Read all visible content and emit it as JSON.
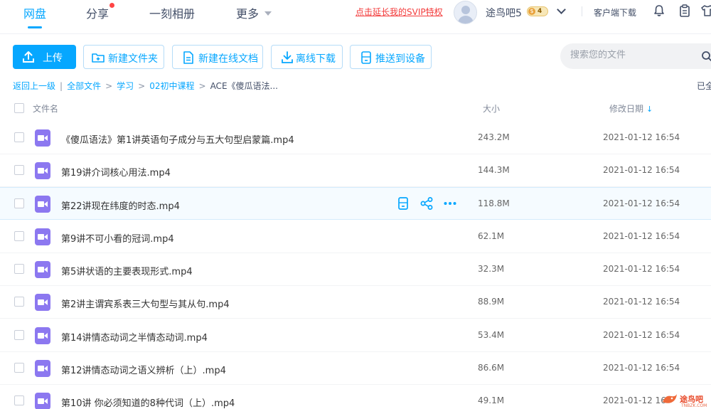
{
  "nav": {
    "tabs": [
      {
        "label": "网盘",
        "active": true
      },
      {
        "label": "分享",
        "has_dot": true
      },
      {
        "label": "一刻相册"
      },
      {
        "label": "更多"
      }
    ],
    "svip_link": "点击延长我的SVIP特权",
    "username": "途鸟吧5",
    "vip_level": "4",
    "client_download": "客户端下载",
    "icons": [
      "bell-icon",
      "clipboard-icon",
      "shirt-icon"
    ]
  },
  "toolbar": {
    "upload": "上传",
    "new_folder": "新建文件夹",
    "new_doc": "新建在线文档",
    "offline_download": "离线下载",
    "push_device": "推送到设备"
  },
  "search": {
    "placeholder": "搜索您的文件"
  },
  "breadcrumb": {
    "back": "返回上一级",
    "items": [
      "全部文件",
      "学习",
      "02初中课程"
    ],
    "current": "ACE《傻瓜语法...",
    "loaded_status": "已全"
  },
  "columns": {
    "name": "文件名",
    "size": "大小",
    "modified": "修改日期"
  },
  "files": [
    {
      "name": "《傻瓜语法》第1讲英语句子成分与五大句型启蒙篇.mp4",
      "size": "243.2M",
      "date": "2021-01-12 16:54"
    },
    {
      "name": "第19讲介词核心用法.mp4",
      "size": "144.3M",
      "date": "2021-01-12 16:54"
    },
    {
      "name": "第22讲现在纬度的时态.mp4",
      "size": "118.8M",
      "date": "2021-01-12 16:54"
    },
    {
      "name": "第9讲不可小看的冠词.mp4",
      "size": "62.1M",
      "date": "2021-01-12 16:54"
    },
    {
      "name": "第5讲状语的主要表现形式.mp4",
      "size": "32.3M",
      "date": "2021-01-12 16:54"
    },
    {
      "name": "第2讲主谓宾系表三大句型与其从句.mp4",
      "size": "88.9M",
      "date": "2021-01-12 16:54"
    },
    {
      "name": "第14讲情态动词之半情态动词.mp4",
      "size": "53.4M",
      "date": "2021-01-12 16:54"
    },
    {
      "name": "第12讲情态动词之语义辨析（上）.mp4",
      "size": "86.6M",
      "date": "2021-01-12 16:54"
    },
    {
      "name": "第10讲 你必须知道的8种代词（上）.mp4",
      "size": "49.1M",
      "date": "2021-01-12 16"
    }
  ],
  "watermark": {
    "text": "途鸟吧",
    "sub": "TNBZK.COM"
  },
  "colors": {
    "accent": "#06a7ff",
    "svip_red": "#f33b3b",
    "video_icon": "#8c78f0"
  }
}
